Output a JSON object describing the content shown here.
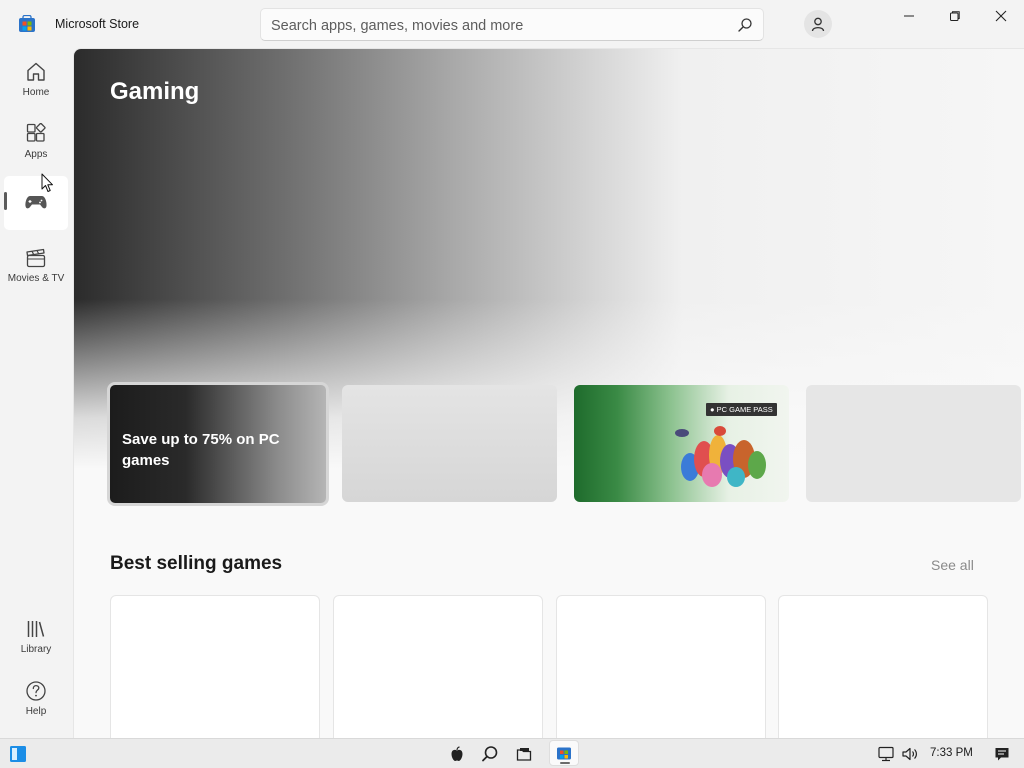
{
  "window": {
    "title": "Microsoft Store",
    "icons": {
      "logo": "store-logo-icon",
      "minimize": "minimize-icon",
      "maximize": "restore-icon",
      "close": "close-icon",
      "account": "account-icon"
    }
  },
  "search": {
    "placeholder": "Search apps, games, movies and more",
    "value": "",
    "icon": "search-icon"
  },
  "sidebar": {
    "items": [
      {
        "label": "Home",
        "icon": "home-icon",
        "active": false
      },
      {
        "label": "Apps",
        "icon": "apps-icon",
        "active": false
      },
      {
        "label": "",
        "icon": "gamepad-icon",
        "active": true
      },
      {
        "label": "Movies & TV",
        "icon": "clapperboard-icon",
        "active": false
      }
    ],
    "bottom_items": [
      {
        "label": "Library",
        "icon": "library-icon"
      },
      {
        "label": "Help",
        "icon": "help-icon"
      }
    ]
  },
  "hero": {
    "title": "Gaming",
    "cards": [
      {
        "text": "Save up to 75% on PC games",
        "selected": true
      },
      {
        "text": ""
      },
      {
        "badge": "PC GAME PASS",
        "art": "game-pass-characters-art"
      },
      {
        "text": ""
      }
    ]
  },
  "best_selling": {
    "title": "Best selling games",
    "see_all": "See all"
  },
  "taskbar": {
    "time": "7:33 PM",
    "icons": [
      "start-icon",
      "apple-icon",
      "search-icon",
      "file-explorer-icon",
      "store-icon",
      "network-icon",
      "volume-icon",
      "notification-icon"
    ]
  },
  "colors": {
    "accent": "#0067c0",
    "game_pass_green": "#1e6b2c"
  }
}
